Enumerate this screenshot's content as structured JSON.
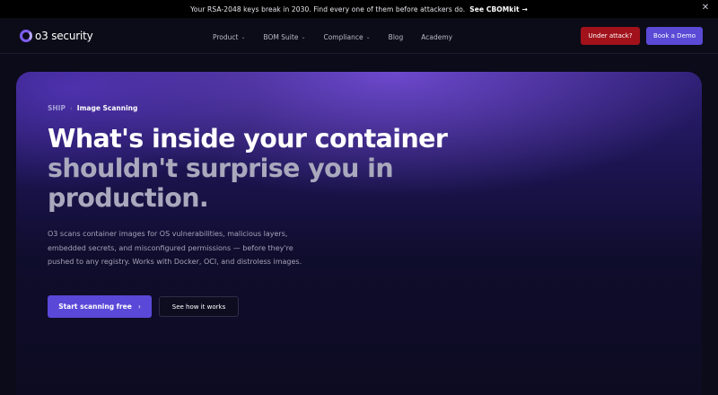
{
  "announcement": {
    "text": "Your RSA-2048 keys break in 2030. Find every one of them before attackers do.",
    "cta": "See CBOMkit",
    "cta_arrow": "→",
    "close": "✕"
  },
  "nav": {
    "logo_text": "o3 security",
    "links": [
      {
        "label": "Product",
        "chevron": "⌄"
      },
      {
        "label": "BOM Suite",
        "chevron": "⌄"
      },
      {
        "label": "Compliance",
        "chevron": "⌄"
      },
      {
        "label": "Blog"
      },
      {
        "label": "Academy"
      }
    ],
    "attack_button": "Under attack?",
    "demo_button": "Book a Demo"
  },
  "hero": {
    "breadcrumb": {
      "parent": "SHIP",
      "separator": "›",
      "current": "Image Scanning"
    },
    "headline_line1": "What's inside your container",
    "headline_line2": "shouldn't surprise you in production.",
    "lead": "O3 scans container images for OS vulnerabilities, malicious layers, embedded secrets, and misconfigured permissions — before they're pushed to any registry. Works with Docker, OCI, and distroless images.",
    "primary_cta": "Start scanning free",
    "primary_cta_arrow": "›",
    "secondary_cta": "See how it works"
  },
  "colors": {
    "accent": "#5a48d8",
    "danger": "#a1121b",
    "background": "#0b0b1a"
  }
}
